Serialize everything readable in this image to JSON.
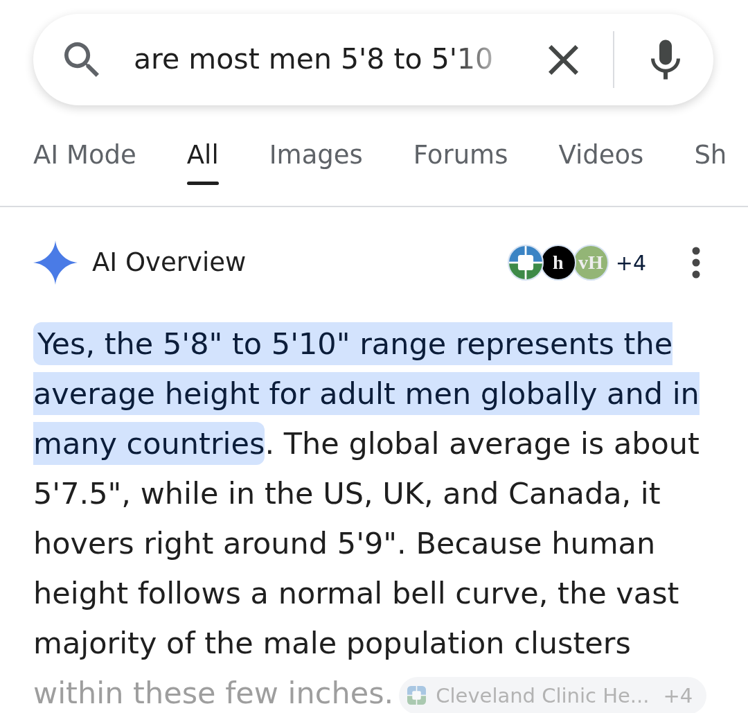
{
  "search": {
    "value": "are most men 5'8 to 5'10"
  },
  "tabs": [
    {
      "label": "AI Mode",
      "selected": false
    },
    {
      "label": "All",
      "selected": true
    },
    {
      "label": "Images",
      "selected": false
    },
    {
      "label": "Forums",
      "selected": false
    },
    {
      "label": "Videos",
      "selected": false
    },
    {
      "label": "Sh",
      "selected": false
    }
  ],
  "ai_overview": {
    "title": "AI Overview",
    "sources": [
      {
        "kind": "cross"
      },
      {
        "kind": "letter",
        "letter": "h",
        "color": "#000000"
      },
      {
        "kind": "letter",
        "letter": "vH",
        "color": "#93b576"
      }
    ],
    "sources_more": "+4",
    "highlighted_text": "Yes, the 5'8\" to 5'10\" range represents the average height for adult men globally and in many countries",
    "text": ". The global average is about 5'7.5\", while in the US, UK, and Canada, it hovers right around 5'9\". Because human height follows a normal bell curve, the vast majority of the male population clusters",
    "faded_text": "within these few inches.",
    "citation": {
      "label": "Cleveland Clinic He...",
      "more": "+4"
    }
  }
}
